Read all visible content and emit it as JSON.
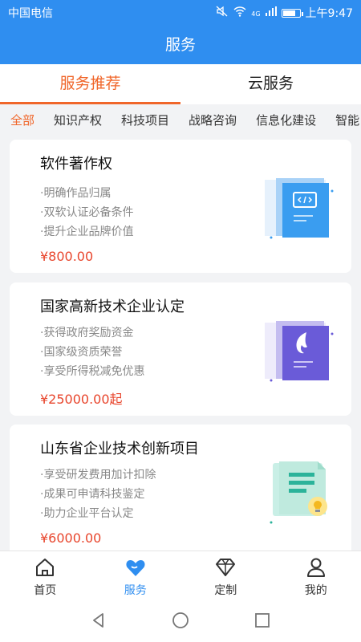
{
  "status_bar": {
    "carrier": "中国电信",
    "network": "4G",
    "time": "上午9:47"
  },
  "header": {
    "title": "服务"
  },
  "top_tabs": [
    {
      "label": "服务推荐",
      "active": true
    },
    {
      "label": "云服务",
      "active": false
    }
  ],
  "category_tabs": [
    "全部",
    "知识产权",
    "科技项目",
    "战略咨询",
    "信息化建设",
    "智能"
  ],
  "services": [
    {
      "title": "软件著作权",
      "features": [
        "·明确作品归属",
        "·双软认证必备条件",
        "·提升企业品牌价值"
      ],
      "price": "¥800.00",
      "icon": "code-document-icon",
      "color": "#3a9df0"
    },
    {
      "title": "国家高新技术企业认定",
      "features": [
        "·获得政府奖励资金",
        "·国家级资质荣誉",
        "·享受所得税减免优惠"
      ],
      "price": "¥25000.00起",
      "icon": "flame-document-icon",
      "color": "#6a5bd8"
    },
    {
      "title": "山东省企业技术创新项目",
      "features": [
        "·享受研发费用加计扣除",
        "·成果可申请科技鉴定",
        "·助力企业平台认定"
      ],
      "price": "¥6000.00",
      "icon": "lightbulb-document-icon",
      "color": "#2bb39a"
    }
  ],
  "bottom_nav": [
    {
      "label": "首页",
      "icon": "home-icon",
      "active": false
    },
    {
      "label": "服务",
      "icon": "heart-icon",
      "active": true
    },
    {
      "label": "定制",
      "icon": "diamond-icon",
      "active": false
    },
    {
      "label": "我的",
      "icon": "user-icon",
      "active": false
    }
  ],
  "colors": {
    "primary": "#2f8ef0",
    "accent": "#f0662a",
    "price": "#e8452c"
  }
}
